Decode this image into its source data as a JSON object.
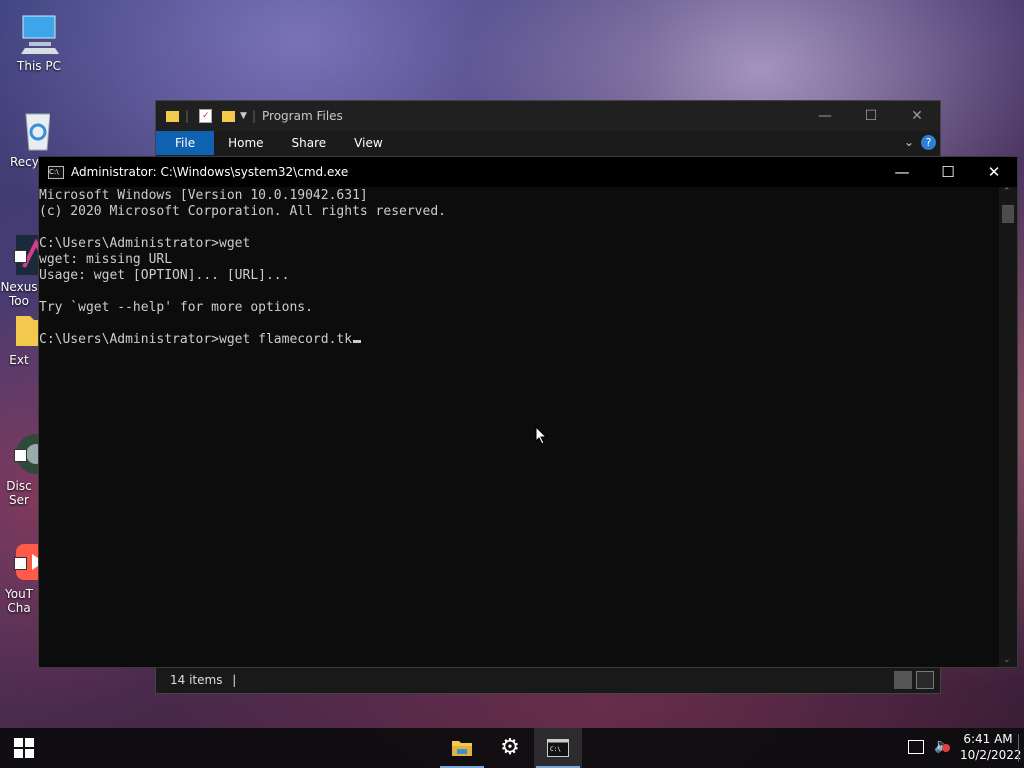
{
  "desktop": {
    "icons": [
      {
        "label": "This PC",
        "icon": "computer-icon"
      },
      {
        "label": "Recyc",
        "icon": "recycle-bin-icon"
      },
      {
        "label": "Nexus\nToo",
        "icon": "nexus-tool-icon"
      },
      {
        "label": "Ext",
        "icon": "folder-icon"
      },
      {
        "label": "Disc\nSer",
        "icon": "discord-icon"
      },
      {
        "label": "YouT\nCha",
        "icon": "youtube-icon"
      }
    ]
  },
  "explorer": {
    "title": "Program Files",
    "ribbon_tabs": [
      "File",
      "Home",
      "Share",
      "View"
    ],
    "status_items": "14 items",
    "colors": {
      "accent": "#0f62b0"
    }
  },
  "cmd": {
    "title": "Administrator: C:\\Windows\\system32\\cmd.exe",
    "lines": [
      "Microsoft Windows [Version 10.0.19042.631]",
      "(c) 2020 Microsoft Corporation. All rights reserved.",
      "",
      "C:\\Users\\Administrator>wget",
      "wget: missing URL",
      "Usage: wget [OPTION]... [URL]...",
      "",
      "Try `wget --help' for more options.",
      "",
      "C:\\Users\\Administrator>wget flamecord.tk"
    ]
  },
  "taskbar": {
    "apps": [
      {
        "name": "file-explorer-icon",
        "active": false
      },
      {
        "name": "settings-icon",
        "active": false
      },
      {
        "name": "cmd-icon",
        "active": true
      }
    ],
    "time": "6:41 AM",
    "date": "10/2/2022"
  }
}
